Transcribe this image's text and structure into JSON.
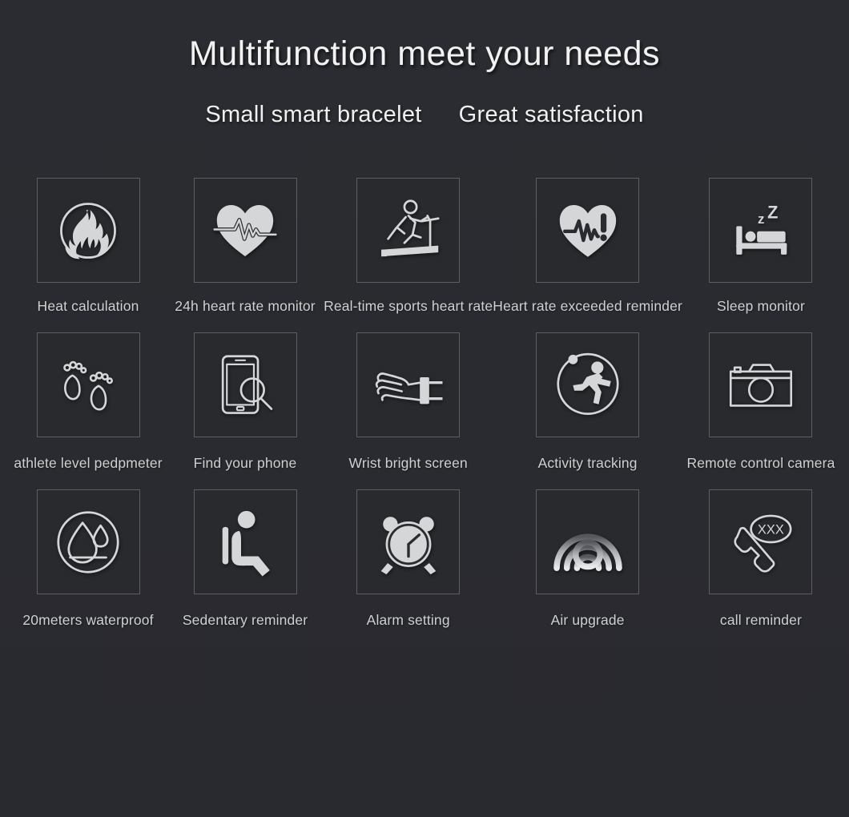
{
  "header": {
    "title": "Multifunction meet your needs",
    "subtitle_left": "Small smart bracelet",
    "subtitle_right": "Great satisfaction"
  },
  "theme": {
    "background": "#2a2b30",
    "box_border": "#5b5e64",
    "box_fill": "#292a2e",
    "icon_color": "#d5d6d7",
    "title_color": "#f2f2f2",
    "label_color": "#cfd0d1"
  },
  "features": [
    {
      "label": "Heat calculation",
      "icon": "flame-circle-icon"
    },
    {
      "label": "24h heart rate monitor",
      "icon": "heart-pulse-icon"
    },
    {
      "label": "Real-time sports heart rate",
      "icon": "treadmill-runner-icon"
    },
    {
      "label": "Heart rate exceeded reminder",
      "icon": "heart-pulse-alert-icon"
    },
    {
      "label": "Sleep monitor",
      "icon": "bed-sleep-zzz-icon"
    },
    {
      "label": "athlete level pedpmeter",
      "icon": "footprints-icon"
    },
    {
      "label": "Find your phone",
      "icon": "phone-search-icon"
    },
    {
      "label": "Wrist bright screen",
      "icon": "wrist-raise-icon"
    },
    {
      "label": "Activity tracking",
      "icon": "runner-circle-icon"
    },
    {
      "label": "Remote control camera",
      "icon": "camera-icon"
    },
    {
      "label": "20meters waterproof",
      "icon": "waterdrop-circle-icon"
    },
    {
      "label": "Sedentary reminder",
      "icon": "sitting-person-icon"
    },
    {
      "label": "Alarm setting",
      "icon": "alarm-clock-icon"
    },
    {
      "label": "Air upgrade",
      "icon": "ota-waves-icon"
    },
    {
      "label": "call reminder",
      "icon": "call-bubble-xxx-icon"
    }
  ],
  "icon_text": {
    "sleep_z_small": "z",
    "sleep_z_large": "Z",
    "call_bubble": "XXX",
    "heart_alert": "!"
  }
}
